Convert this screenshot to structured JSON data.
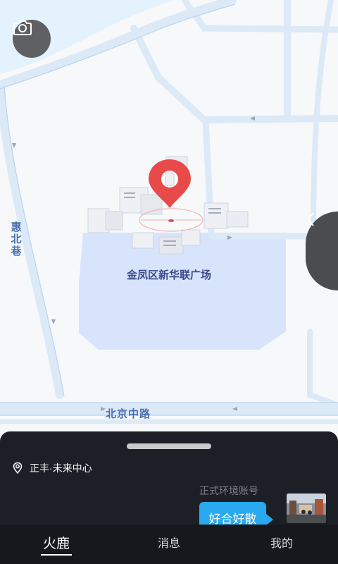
{
  "map": {
    "place_label": "金凤区新华联广场",
    "road_vertical": "惠北巷",
    "road_horizontal": "北京中路",
    "colors": {
      "water": "#e4f2fd",
      "road": "#dce9f7",
      "block": "#d7e4fb",
      "pin": "#e84a49"
    }
  },
  "controls": {
    "camera_icon": "camera-icon",
    "side_toggle_icon": "chevron-left-icon"
  },
  "sheet": {
    "location": "正丰·未来中心",
    "location_icon": "location-pin-icon",
    "account_name": "正式环境账号",
    "message": "好合好散"
  },
  "tabs": [
    {
      "label": "火鹿",
      "active": true
    },
    {
      "label": "消息",
      "active": false
    },
    {
      "label": "我的",
      "active": false
    }
  ]
}
